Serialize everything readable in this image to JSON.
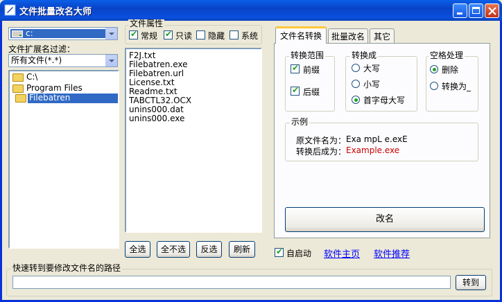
{
  "window": {
    "title": "文件批量改名大师"
  },
  "left": {
    "drive_value": "c:",
    "filter_label": "文件扩展名过滤：",
    "filter_value": "所有文件(*.*)",
    "tree": [
      "C:\\",
      "Program Files",
      "Filebatren"
    ]
  },
  "attributes": {
    "group_label": "文件属性",
    "normal": "常规",
    "readonly": "只读",
    "hidden": "隐藏",
    "system": "系统"
  },
  "files": [
    "F2J.txt",
    "Filebatren.exe",
    "Filebatren.url",
    "License.txt",
    "Readme.txt",
    "TABCTL32.OCX",
    "unins000.dat",
    "unins000.exe"
  ],
  "select_buttons": {
    "all": "全选",
    "none": "全不选",
    "invert": "反选",
    "refresh": "刷新"
  },
  "tabs": [
    "文件名转换",
    "批量改名",
    "其它"
  ],
  "convert": {
    "range_label": "转换范围",
    "prefix": "前缀",
    "suffix": "后缀",
    "to_label": "转换成",
    "upper": "大写",
    "lower": "小写",
    "capitalize": "首字母大写",
    "space_label": "空格处理",
    "delete": "删除",
    "replace_to": "转换为_"
  },
  "example": {
    "label": "示例",
    "orig_label": "原文件名为：",
    "orig_value": "Exa mpL e.exE",
    "new_label": "转换后成为：",
    "new_value": "Example.exe"
  },
  "rename_button": "改名",
  "bottom": {
    "autostart": "自启动",
    "home_link": "软件主页",
    "recommend_link": "软件推荐",
    "quick_label": "快速转到要修改文件名的路径",
    "path_value": "",
    "goto_button": "转到"
  },
  "colors": {
    "accent": "#0a50de",
    "example_new": "#cc0000",
    "link": "#0000ff"
  }
}
